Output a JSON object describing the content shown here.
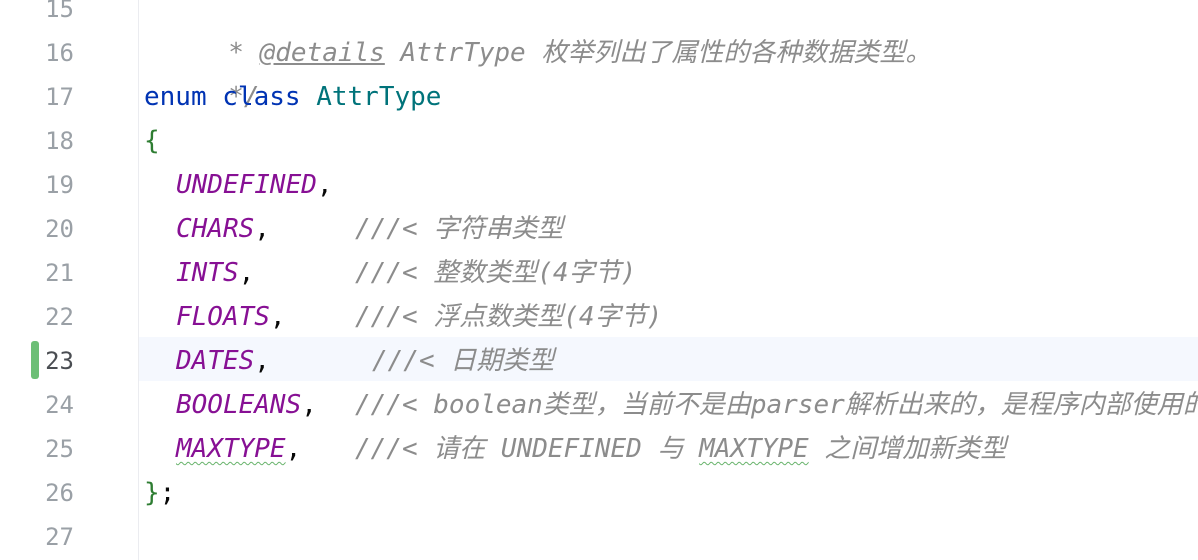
{
  "editor": {
    "line_numbers": [
      "15",
      "16",
      "17",
      "18",
      "19",
      "20",
      "21",
      "22",
      "23",
      "24",
      "25",
      "26",
      "27"
    ],
    "current_line": "23",
    "lines": {
      "l15": {
        "prefix": " * ",
        "tag": "@details",
        "text": " AttrType 枚举列出了属性的各种数据类型。"
      },
      "l16": {
        "text": " */"
      },
      "l17": {
        "kw1": "enum",
        "kw2": "class",
        "name": "AttrType"
      },
      "l18": {
        "text": "{"
      },
      "l19": {
        "name": "UNDEFINED",
        "punct": ","
      },
      "l20": {
        "name": "CHARS",
        "punct": ",",
        "comment": "///< 字符串类型"
      },
      "l21": {
        "name": "INTS",
        "punct": ",",
        "comment": "///< 整数类型(4字节)"
      },
      "l22": {
        "name": "FLOATS",
        "punct": ",",
        "comment": "///< 浮点数类型(4字节)"
      },
      "l23": {
        "name": "DATES",
        "punct": ",",
        "comment": "///< 日期类型"
      },
      "l24": {
        "name": "BOOLEANS",
        "punct": ",",
        "comment": "///< boolean类型，当前不是由parser解析出来的，是程序内部使用的"
      },
      "l25": {
        "name": "MAXTYPE",
        "punct": ",",
        "comment_a": "///< 请在 UNDEFINED 与 ",
        "comment_b": "MAXTYPE",
        "comment_c": " 之间增加新类型"
      },
      "l26": {
        "brace": "}",
        "semi": ";"
      },
      "l27": {
        "text": ""
      }
    }
  }
}
